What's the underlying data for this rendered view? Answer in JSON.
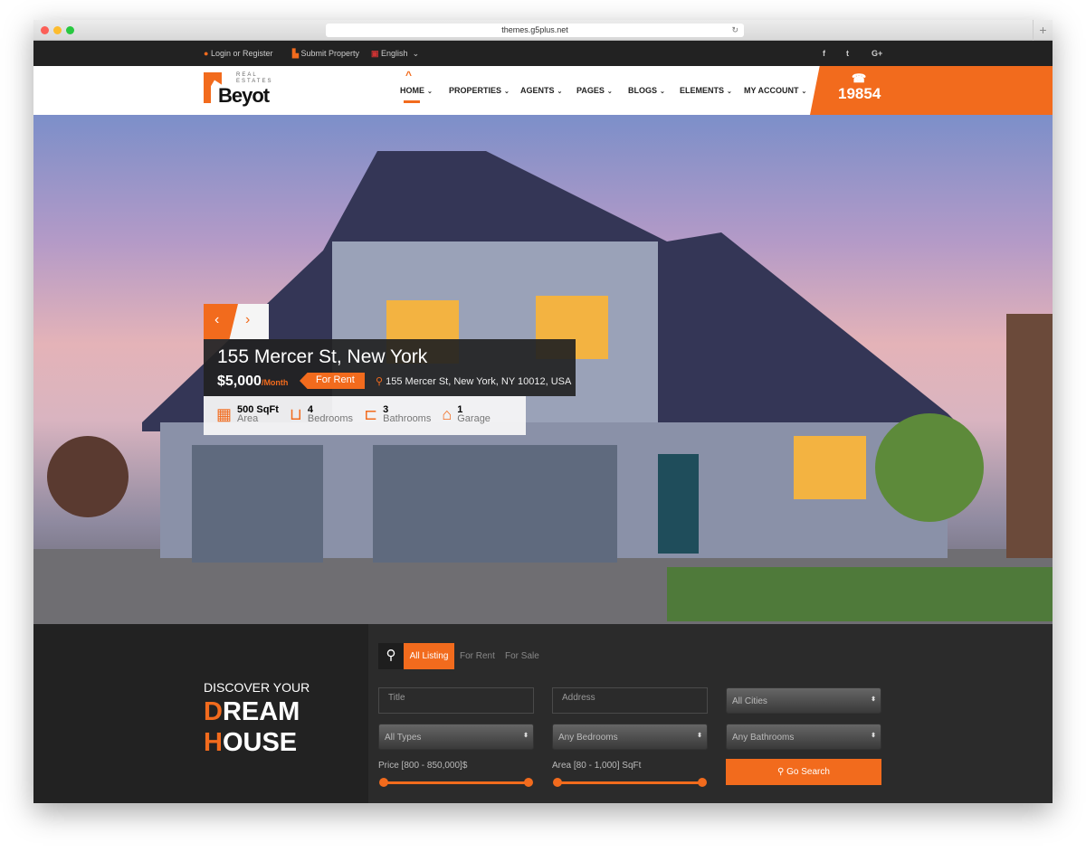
{
  "browser": {
    "url": "themes.g5plus.net"
  },
  "topbar": {
    "login": "Login or Register",
    "submit": "Submit Property",
    "language": "English",
    "social": [
      "f",
      "t",
      "G+"
    ]
  },
  "logo": {
    "sub1": "REAL",
    "sub2": "ESTATES",
    "name": "Beyot"
  },
  "nav": {
    "items": [
      "HOME",
      "PROPERTIES",
      "AGENTS",
      "PAGES",
      "BLOGS",
      "ELEMENTS",
      "MY ACCOUNT"
    ],
    "phone": "19854"
  },
  "listing": {
    "title": "155 Mercer St, New York",
    "price": "$5,000",
    "period": "/Month",
    "status": "For Rent",
    "address": "155 Mercer St, New York, NY 10012, USA",
    "features": [
      {
        "value": "500 SqFt",
        "label": "Area"
      },
      {
        "value": "4",
        "label": "Bedrooms"
      },
      {
        "value": "3",
        "label": "Bathrooms"
      },
      {
        "value": "1",
        "label": "Garage"
      }
    ]
  },
  "search": {
    "tagline": "DISCOVER YOUR",
    "big1": "DREAM",
    "big2": "HOUSE",
    "tabs": [
      "All Listing",
      "For Rent",
      "For Sale"
    ],
    "title_placeholder": "Title",
    "address_placeholder": "Address",
    "cities": "All Cities",
    "types": "All Types",
    "bedrooms": "Any Bedrooms",
    "bathrooms": "Any Bathrooms",
    "price_label": "Price [800 - 850,000]$",
    "area_label": "Area [80 - 1,000] SqFt",
    "button": "Go Search"
  },
  "colors": {
    "accent": "#f26b1d",
    "dark": "#222222"
  }
}
